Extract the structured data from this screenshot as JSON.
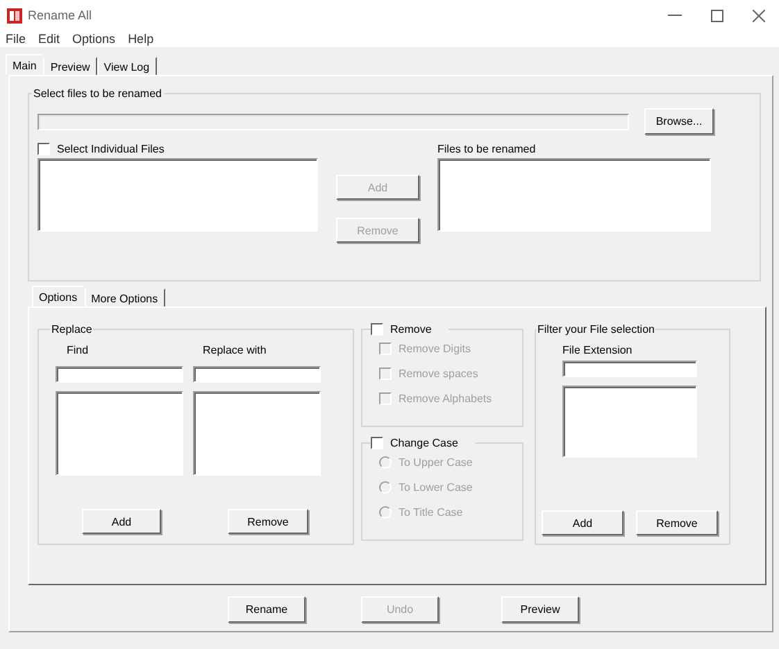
{
  "window": {
    "title": "Rename All"
  },
  "menu": [
    "File",
    "Edit",
    "Options",
    "Help"
  ],
  "tabs": [
    {
      "label": "Main",
      "selected": true
    },
    {
      "label": "Preview",
      "selected": false
    },
    {
      "label": "View Log",
      "selected": false
    }
  ],
  "select_files": {
    "title": "Select files to be renamed",
    "path_disabled": true,
    "browse": {
      "label": "Browse...",
      "disabled": false
    },
    "individual": {
      "label": "Select Individual Files",
      "checked": false
    },
    "add": {
      "label": "Add",
      "disabled": true
    },
    "remove": {
      "label": "Remove",
      "disabled": true
    },
    "files_label": "Files to be renamed"
  },
  "option_tabs": [
    {
      "label": "Options",
      "selected": true
    },
    {
      "label": "More Options",
      "selected": false
    }
  ],
  "replace": {
    "title": "Replace",
    "find_label": "Find",
    "replace_label": "Replace with",
    "add": {
      "label": "Add",
      "disabled": false
    },
    "remove": {
      "label": "Remove",
      "disabled": false
    }
  },
  "remove": {
    "label": "Remove",
    "checked": false,
    "options": [
      {
        "label": "Remove Digits",
        "checked": false,
        "disabled": true
      },
      {
        "label": "Remove spaces",
        "checked": false,
        "disabled": true
      },
      {
        "label": "Remove Alphabets",
        "checked": false,
        "disabled": true
      }
    ]
  },
  "change_case": {
    "label": "Change Case",
    "checked": false,
    "options": [
      {
        "label": "To Upper Case",
        "selected": false,
        "disabled": true
      },
      {
        "label": "To Lower Case",
        "selected": false,
        "disabled": true
      },
      {
        "label": "To Title Case",
        "selected": false,
        "disabled": true
      }
    ]
  },
  "filter": {
    "title": "Filter your File selection",
    "extension_label": "File Extension",
    "add": {
      "label": "Add",
      "disabled": false
    },
    "remove": {
      "label": "Remove",
      "disabled": false
    }
  },
  "actions": [
    {
      "label": "Rename",
      "disabled": false
    },
    {
      "label": "Undo",
      "disabled": true
    },
    {
      "label": "Preview",
      "disabled": false
    }
  ]
}
